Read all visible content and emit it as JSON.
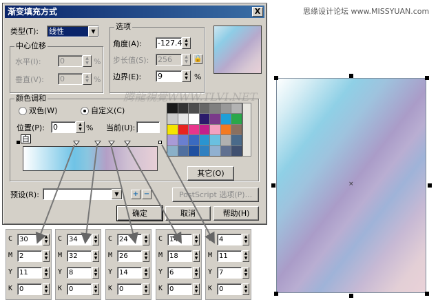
{
  "site_watermark": "思缘设计论坛  www.MISSYUAN.com",
  "image_watermark": "腾龍視覺WWW.TLVI.NET",
  "dialog": {
    "title": "渐变填充方式",
    "close": "X",
    "type_label": "类型(T):",
    "type_value": "线性",
    "options_title": "选项",
    "center_title": "中心位移",
    "horizontal_label": "水平(I):",
    "horizontal_value": "0",
    "vertical_label": "垂直(V):",
    "vertical_value": "0",
    "percent": "%",
    "angle_label": "角度(A):",
    "angle_value": "-127.4",
    "steps_label": "步长值(S):",
    "steps_value": "256",
    "edge_label": "边界(E):",
    "edge_value": "9",
    "color_blend_title": "颜色调和",
    "two_color": "双色(W)",
    "custom": "自定义(C)",
    "position_label": "位置(P):",
    "position_value": "0",
    "current_label": "当前(U):",
    "start_marker": "白",
    "other_button": "其它(O)",
    "preset_label": "预设(R):",
    "preset_value": "",
    "postscript_button": "PostScript 选项(P)...",
    "ok_button": "确定",
    "cancel_button": "取消",
    "help_button": "帮助(H)",
    "add_symbol": "+",
    "remove_symbol": "−"
  },
  "palette_colors": [
    "#1a1a1a",
    "#333333",
    "#4d4d4d",
    "#666666",
    "#808080",
    "#999999",
    "#b3b3b3",
    "#cccccc",
    "#e6e6e6",
    "#ffffff",
    "#2b1a6b",
    "#7a3a8a",
    "#1f9fd8",
    "#2aa84a",
    "#f5e400",
    "#e8231f",
    "#e8358c",
    "#c21f8b",
    "#f3a1c0",
    "#f47a20",
    "#8a7060",
    "#a99ad6",
    "#6a7fd0",
    "#3a6ac0",
    "#2a94d0",
    "#6ac0e0",
    "#b0b0b0",
    "#4a6a8a",
    "#8ab0c8",
    "#5070a0",
    "#2050a0",
    "#3080c0",
    "#90b0d0",
    "#607090",
    "#405070"
  ],
  "cmyk_labels": [
    "C",
    "M",
    "Y",
    "K"
  ],
  "cmyk_boxes": [
    {
      "c": "30",
      "m": "2",
      "y": "11",
      "k": "0"
    },
    {
      "c": "34",
      "m": "32",
      "y": "8",
      "k": "0"
    },
    {
      "c": "24",
      "m": "26",
      "y": "14",
      "k": "0"
    },
    {
      "c": "14",
      "m": "18",
      "y": "6",
      "k": "0"
    },
    {
      "c": "4",
      "m": "11",
      "y": "7",
      "k": "0"
    }
  ]
}
